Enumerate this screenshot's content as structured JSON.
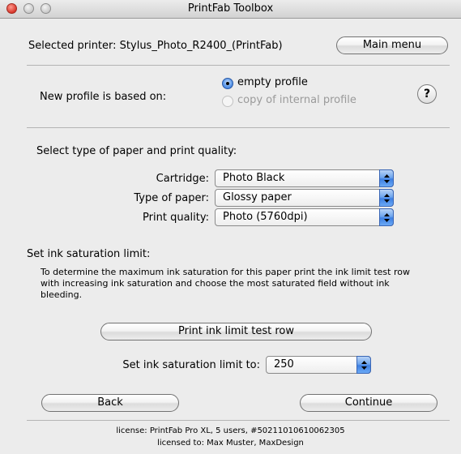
{
  "window": {
    "title": "PrintFab Toolbox"
  },
  "header": {
    "selected_printer_text": "Selected printer: Stylus_Photo_R2400_(PrintFab)",
    "main_menu_label": "Main menu"
  },
  "profile": {
    "label": "New profile is based on:",
    "options": [
      {
        "label": "empty profile",
        "selected": true,
        "enabled": true
      },
      {
        "label": "copy of internal profile",
        "selected": false,
        "enabled": false
      }
    ],
    "help_label": "?"
  },
  "paper": {
    "heading": "Select type of paper and print quality:",
    "cartridge_label": "Cartridge:",
    "cartridge_value": "Photo Black",
    "paper_type_label": "Type of paper:",
    "paper_type_value": "Glossy paper",
    "print_quality_label": "Print quality:",
    "print_quality_value": "Photo (5760dpi)"
  },
  "ink": {
    "heading": "Set ink saturation limit:",
    "description": "To determine the maximum ink saturation for this paper print the ink limit test row with increasing ink saturation and choose the most saturated field without ink bleeding.",
    "print_test_label": "Print ink limit test row",
    "limit_label": "Set ink saturation limit to:",
    "limit_value": "250"
  },
  "nav": {
    "back_label": "Back",
    "continue_label": "Continue"
  },
  "footer": {
    "license_line": "license: PrintFab Pro XL, 5 users, #50211010610062305",
    "licensed_to_line": "licensed to: Max Muster, MaxDesign"
  },
  "colors": {
    "accent": "#3d7fe2",
    "close_button": "#d8362b",
    "disabled_text": "#9a9a9a"
  }
}
